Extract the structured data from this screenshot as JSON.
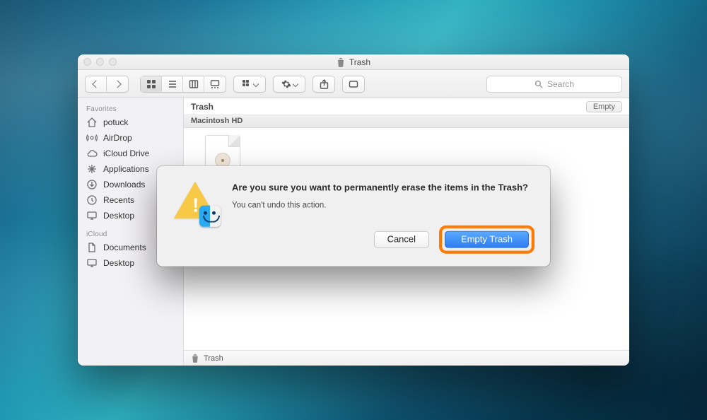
{
  "window": {
    "title": "Trash"
  },
  "toolbar": {
    "search_placeholder": "Search"
  },
  "sidebar": {
    "sections": [
      {
        "heading": "Favorites",
        "items": [
          {
            "icon": "home-icon",
            "label": "potuck"
          },
          {
            "icon": "airdrop-icon",
            "label": "AirDrop"
          },
          {
            "icon": "cloud-icon",
            "label": "iCloud Drive"
          },
          {
            "icon": "applications-icon",
            "label": "Applications"
          },
          {
            "icon": "downloads-icon",
            "label": "Downloads"
          },
          {
            "icon": "recents-icon",
            "label": "Recents"
          },
          {
            "icon": "desktop-icon",
            "label": "Desktop"
          }
        ]
      },
      {
        "heading": "iCloud",
        "items": [
          {
            "icon": "documents-icon",
            "label": "Documents"
          },
          {
            "icon": "desktop-icon",
            "label": "Desktop"
          }
        ]
      }
    ]
  },
  "content": {
    "location_title": "Trash",
    "empty_button": "Empty",
    "volume_header": "Macintosh HD",
    "pathbar_label": "Trash"
  },
  "dialog": {
    "title": "Are you sure you want to permanently erase the items in the Trash?",
    "subtitle": "You can't undo this action.",
    "cancel": "Cancel",
    "confirm": "Empty Trash"
  }
}
